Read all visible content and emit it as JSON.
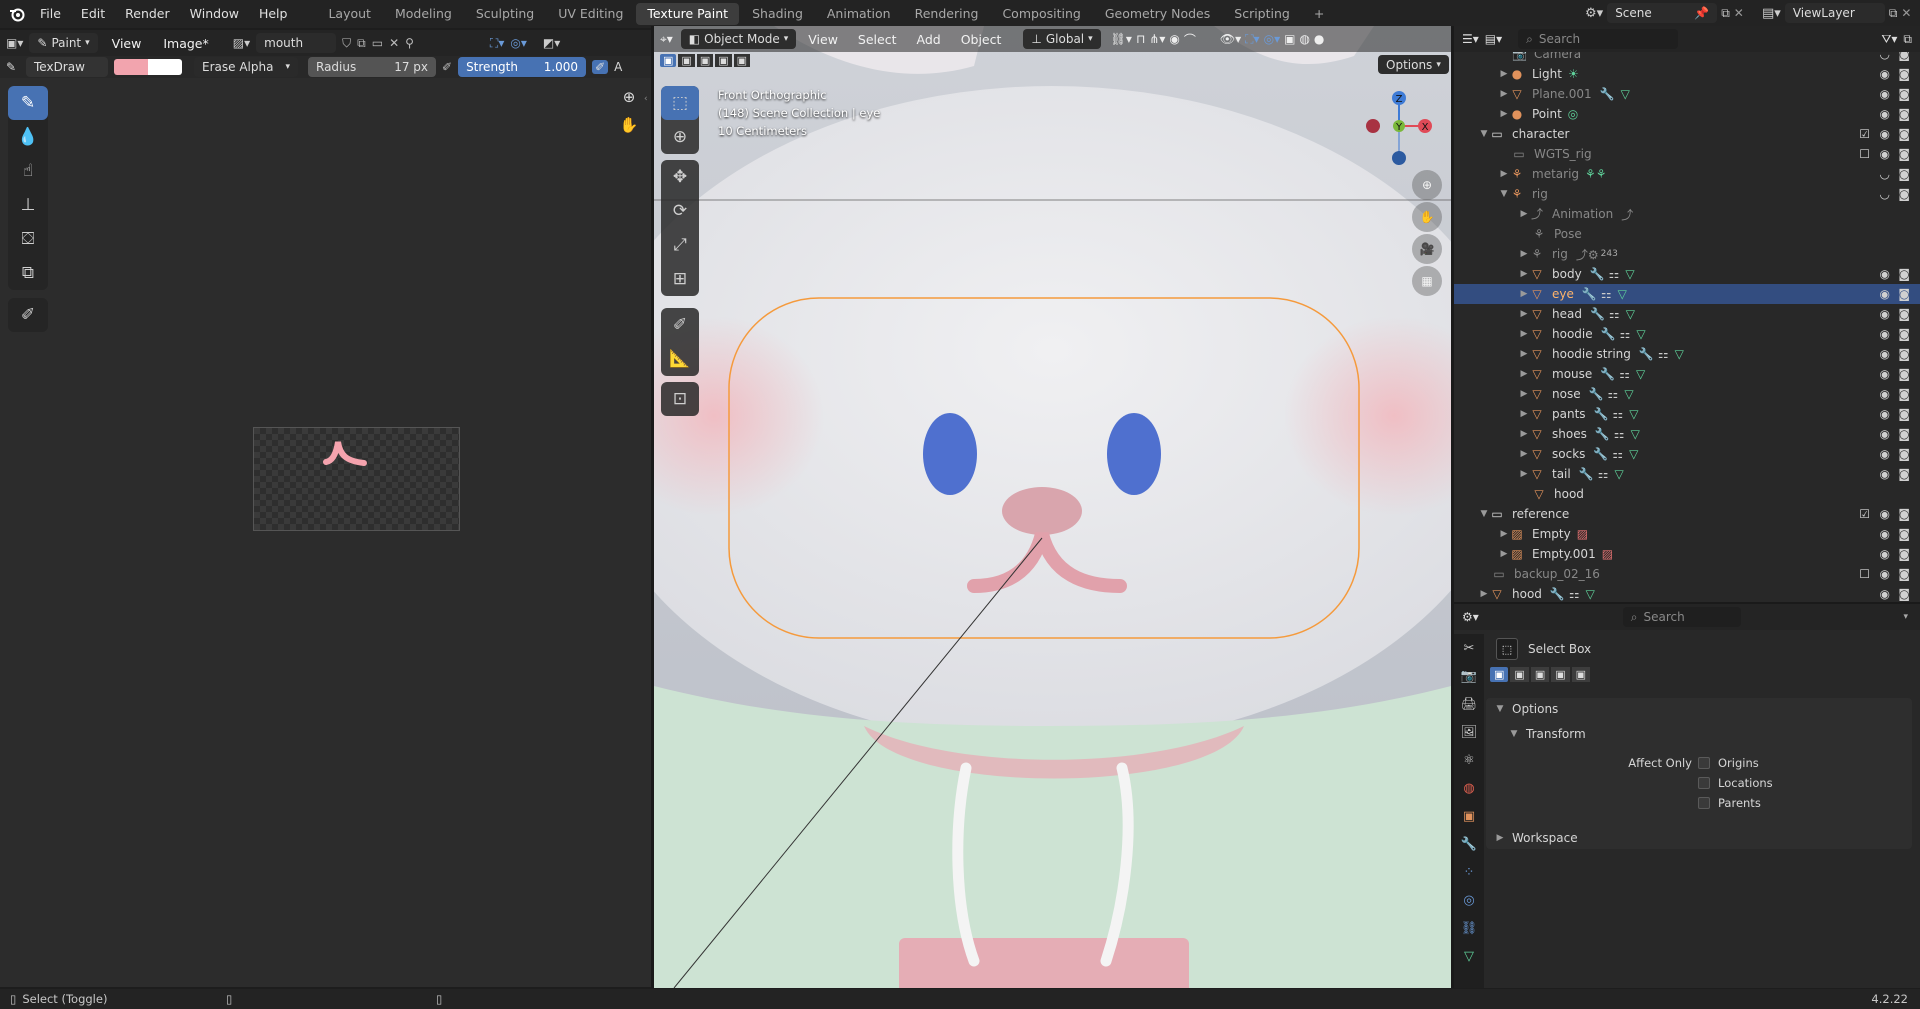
{
  "topbar": {
    "menus": [
      "File",
      "Edit",
      "Render",
      "Window",
      "Help"
    ],
    "workspaces": [
      "Layout",
      "Modeling",
      "Sculpting",
      "UV Editing",
      "Texture Paint",
      "Shading",
      "Animation",
      "Rendering",
      "Compositing",
      "Geometry Nodes",
      "Scripting"
    ],
    "active_workspace": "Texture Paint",
    "add_tab": "+",
    "scene_name": "Scene",
    "view_layer": "ViewLayer"
  },
  "image_editor": {
    "mode": "Paint",
    "menus": [
      "View",
      "Image*"
    ],
    "image_name": "mouth",
    "brush_name": "TexDraw",
    "primary_color": "#f2a4ae",
    "secondary_color": "#ffffff",
    "blend_mode": "Erase Alpha",
    "radius_label": "Radius",
    "radius_value": "17 px",
    "strength_label": "Strength",
    "strength_value": "1.000",
    "truncated_label": "A"
  },
  "viewport": {
    "mode": "Object Mode",
    "menus": [
      "View",
      "Select",
      "Add",
      "Object"
    ],
    "orientation": "Global",
    "options_label": "Options",
    "view_name": "Front Orthographic",
    "collection_info": "(148) Scene Collection | eye",
    "scale_info": "10 Centimeters",
    "gizmo": {
      "z": "Z",
      "y": "Y",
      "x": "X"
    }
  },
  "outliner": {
    "search_placeholder": "Search",
    "items": [
      {
        "label": "Camera",
        "dim": true
      },
      {
        "label": "Light"
      },
      {
        "label": "Plane.001",
        "dim": true
      },
      {
        "label": "Point"
      },
      {
        "label": "character"
      },
      {
        "label": "WGTS_rig",
        "dim": true
      },
      {
        "label": "metarig",
        "dim": true
      },
      {
        "label": "rig",
        "dim": true
      },
      {
        "label": "Animation",
        "dim": true
      },
      {
        "label": "Pose",
        "dim": true
      },
      {
        "label": "rig",
        "dim": true,
        "badge": "243"
      },
      {
        "label": "body"
      },
      {
        "label": "eye",
        "selected": true
      },
      {
        "label": "head"
      },
      {
        "label": "hoodie"
      },
      {
        "label": "hoodie string"
      },
      {
        "label": "mouse"
      },
      {
        "label": "nose"
      },
      {
        "label": "pants"
      },
      {
        "label": "shoes"
      },
      {
        "label": "socks"
      },
      {
        "label": "tail"
      },
      {
        "label": "hood"
      },
      {
        "label": "reference"
      },
      {
        "label": "Empty"
      },
      {
        "label": "Empty.001"
      },
      {
        "label": "backup_02_16",
        "dim": true
      },
      {
        "label": "hood"
      }
    ]
  },
  "properties": {
    "search_placeholder": "Search",
    "tool_name": "Select Box",
    "panel_options": "Options",
    "panel_transform": "Transform",
    "affect_only_label": "Affect Only",
    "origins": "Origins",
    "locations": "Locations",
    "parents": "Parents",
    "panel_workspace": "Workspace"
  },
  "status": {
    "hint": "Select (Toggle)",
    "version": "4.2.22"
  },
  "colors": {
    "selection": "#334d80",
    "accent": "#4772b3",
    "object_icon": "#e0925c",
    "modifier_icon": "#6a9ad8",
    "data_icon": "#5fd19a"
  }
}
